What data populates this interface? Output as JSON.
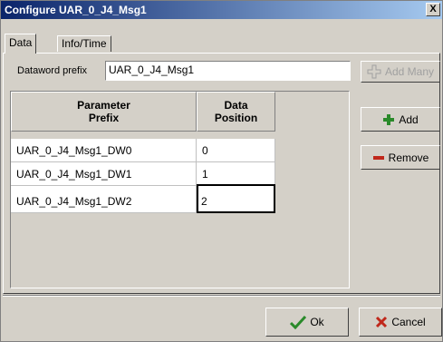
{
  "window": {
    "title": "Configure UAR_0_J4_Msg1",
    "close_label": "X"
  },
  "tabs": [
    {
      "label": "Data"
    },
    {
      "label": "Info/Time"
    }
  ],
  "prefix": {
    "label": "Dataword prefix",
    "value": "UAR_0_J4_Msg1"
  },
  "buttons": {
    "add_many": "Add Many",
    "add": "Add",
    "remove": "Remove",
    "ok": "Ok",
    "cancel": "Cancel"
  },
  "table": {
    "headers": [
      "Parameter\nPrefix",
      "Data\nPosition"
    ],
    "rows": [
      {
        "prefix": "UAR_0_J4_Msg1_DW0",
        "position": "0"
      },
      {
        "prefix": "UAR_0_J4_Msg1_DW1",
        "position": "1"
      },
      {
        "prefix": "UAR_0_J4_Msg1_DW2",
        "position": "2"
      }
    ]
  },
  "icons": {
    "add_many": "add-many-icon",
    "add": "plus-icon",
    "remove": "minus-icon",
    "ok": "checkmark-icon",
    "cancel": "x-icon"
  },
  "colors": {
    "title_start": "#0a246a",
    "title_end": "#a6caf0",
    "add_icon": "#2a8a2a",
    "remove_icon": "#c0281b",
    "ok_icon": "#2a8a2a",
    "cancel_icon": "#c0281b"
  }
}
